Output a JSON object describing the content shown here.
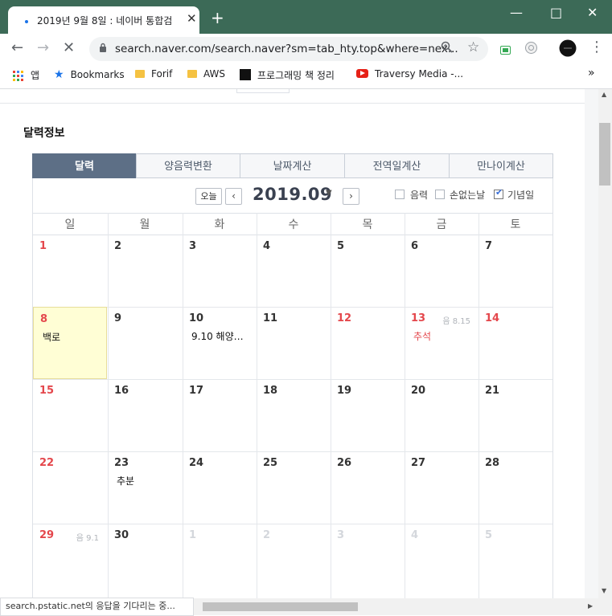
{
  "browser": {
    "tab_title": "2019년 9월 8일 : 네이버 통합검",
    "url": "search.naver.com/search.naver?sm=tab_hty.top&where=nex...",
    "bookmarks": [
      {
        "label": "앱"
      },
      {
        "label": "Bookmarks"
      },
      {
        "label": "Forif"
      },
      {
        "label": "AWS"
      },
      {
        "label": "프로그래밍 책 정리"
      },
      {
        "label": "Traversy Media -..."
      }
    ],
    "status_text": "search.pstatic.net의 응답을 기다리는 중..."
  },
  "calendar": {
    "section_title": "달력정보",
    "tabs": [
      "달력",
      "양음력변환",
      "날짜계산",
      "전역일계산",
      "만나이계산"
    ],
    "active_tab": 0,
    "today_label": "오늘",
    "month_label": "2019.09",
    "options": [
      {
        "label": "음력",
        "checked": false
      },
      {
        "label": "손없는날",
        "checked": false
      },
      {
        "label": "기념일",
        "checked": true
      }
    ],
    "weekdays": [
      "일",
      "월",
      "화",
      "수",
      "목",
      "금",
      "토"
    ],
    "weeks": [
      [
        {
          "d": "1",
          "red": true
        },
        {
          "d": "2"
        },
        {
          "d": "3"
        },
        {
          "d": "4"
        },
        {
          "d": "5"
        },
        {
          "d": "6"
        },
        {
          "d": "7"
        }
      ],
      [
        {
          "d": "8",
          "red": true,
          "today": true,
          "event": "백로"
        },
        {
          "d": "9"
        },
        {
          "d": "10",
          "event": "9.10 해양…"
        },
        {
          "d": "11"
        },
        {
          "d": "12",
          "red": true
        },
        {
          "d": "13",
          "red": true,
          "lunar": "음 8.15",
          "event": "추석",
          "event_red": true
        },
        {
          "d": "14",
          "red": true
        }
      ],
      [
        {
          "d": "15",
          "red": true
        },
        {
          "d": "16"
        },
        {
          "d": "17"
        },
        {
          "d": "18"
        },
        {
          "d": "19"
        },
        {
          "d": "20"
        },
        {
          "d": "21"
        }
      ],
      [
        {
          "d": "22",
          "red": true
        },
        {
          "d": "23",
          "event": "추분"
        },
        {
          "d": "24"
        },
        {
          "d": "25"
        },
        {
          "d": "26"
        },
        {
          "d": "27"
        },
        {
          "d": "28"
        }
      ],
      [
        {
          "d": "29",
          "red": true,
          "lunar": "음 9.1"
        },
        {
          "d": "30"
        },
        {
          "d": "1",
          "dim": true
        },
        {
          "d": "2",
          "dim": true
        },
        {
          "d": "3",
          "dim": true
        },
        {
          "d": "4",
          "dim": true
        },
        {
          "d": "5",
          "dim": true
        }
      ]
    ]
  }
}
